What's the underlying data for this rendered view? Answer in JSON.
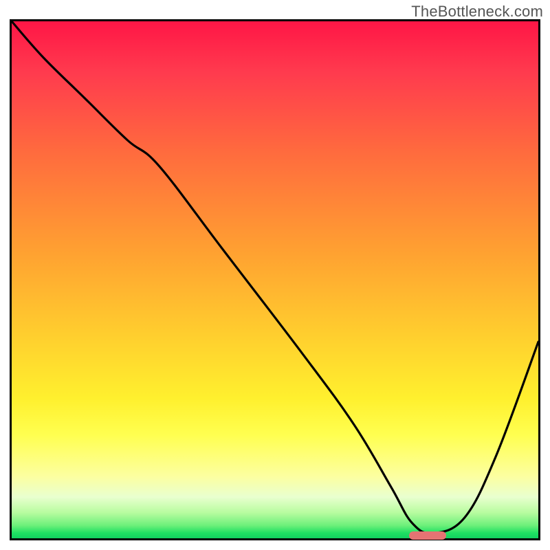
{
  "watermark": "TheBottleneck.com",
  "chart_data": {
    "type": "line",
    "title": "",
    "xlabel": "",
    "ylabel": "",
    "xlim": [
      0,
      100
    ],
    "ylim": [
      0,
      100
    ],
    "grid": false,
    "legend": null,
    "background": {
      "kind": "vertical-gradient",
      "stops": [
        {
          "pct": 0,
          "color": "#ff1646"
        },
        {
          "pct": 25,
          "color": "#ff6a3e"
        },
        {
          "pct": 62,
          "color": "#ffd22e"
        },
        {
          "pct": 80,
          "color": "#ffff50"
        },
        {
          "pct": 92,
          "color": "#e9ffcf"
        },
        {
          "pct": 100,
          "color": "#12d060"
        }
      ]
    },
    "series": [
      {
        "name": "bottleneck-curve",
        "color": "#000000",
        "x": [
          0,
          6,
          14,
          22,
          28,
          40,
          55,
          65,
          72,
          76,
          80,
          86,
          92,
          100
        ],
        "y": [
          100,
          93,
          85,
          77,
          72,
          56,
          36,
          22,
          10,
          3,
          1,
          4,
          16,
          38
        ]
      }
    ],
    "annotations": [
      {
        "name": "optimal-range-marker",
        "type": "hbar",
        "x_start": 75.5,
        "x_end": 82.5,
        "y": 0.5,
        "color": "#e57373"
      }
    ]
  }
}
